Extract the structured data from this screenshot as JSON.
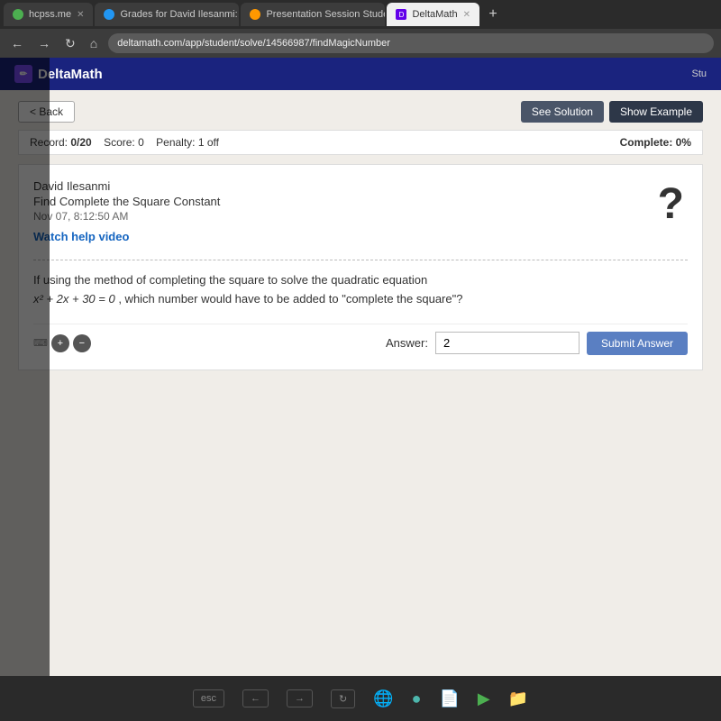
{
  "browser": {
    "tabs": [
      {
        "id": "tab1",
        "label": "hcpss.me",
        "icon": "green",
        "active": false,
        "closable": true
      },
      {
        "id": "tab2",
        "label": "Grades for David Ilesanmi: Engli…",
        "icon": "blue",
        "active": false,
        "closable": true
      },
      {
        "id": "tab3",
        "label": "Presentation Session Student",
        "icon": "orange",
        "active": false,
        "closable": true
      },
      {
        "id": "tab4",
        "label": "DeltaMath",
        "icon": "dm",
        "active": true,
        "closable": true
      }
    ],
    "address": "deltamath.com/app/student/solve/14566987/findMagicNumber",
    "new_tab_label": "+"
  },
  "header": {
    "logo": "✏",
    "app_name": "DeltaMath",
    "user_label": "Stu"
  },
  "toolbar": {
    "back_label": "< Back",
    "see_solution_label": "See Solution",
    "show_example_label": "Show Example"
  },
  "score_bar": {
    "record_label": "Record:",
    "record_value": "0/20",
    "score_label": "Score:",
    "score_value": "0",
    "penalty_label": "Penalty:",
    "penalty_value": "1 off",
    "complete_label": "Complete:",
    "complete_value": "0%"
  },
  "question": {
    "student_name": "David Ilesanmi",
    "problem_title": "Find Complete the Square Constant",
    "timestamp": "Nov 07, 8:12:50 AM",
    "help_video_label": "Watch help video",
    "question_mark_icon": "?",
    "problem_text_1": "If using the method of completing the square to solve the quadratic equation",
    "problem_math": "x² + 2x + 30 = 0",
    "problem_text_2": ", which number would have to be added to \"complete the square\"?"
  },
  "answer": {
    "label": "Answer:",
    "value": "2",
    "placeholder": "",
    "submit_label": "Submit Answer"
  },
  "taskbar": {
    "icons": [
      "🌐",
      "🔵",
      "📄",
      "▶",
      "📁"
    ]
  },
  "laptop": {
    "keys": [
      "esc",
      "←",
      "→",
      "↻",
      "⬜",
      "|||"
    ]
  }
}
